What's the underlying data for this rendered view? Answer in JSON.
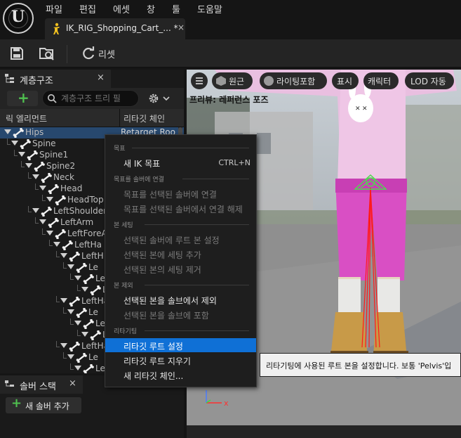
{
  "menubar": {
    "items": [
      "파일",
      "편집",
      "에셋",
      "창",
      "툴",
      "도움말"
    ]
  },
  "tab": {
    "title": "IK_RIG_Shopping_Cart_...",
    "modified_marker": "*",
    "close": "×"
  },
  "toolbar": {
    "reset_label": "리셋"
  },
  "hierarchy": {
    "tab_label": "계층구조",
    "close": "×",
    "search_placeholder": "계층구조 트리 필",
    "columns": [
      "릭 엘리먼트",
      "리타깃 체인"
    ],
    "rows": [
      {
        "name": "Hips",
        "chain": "Retarget Roo",
        "depth": 0,
        "selected": true
      },
      {
        "name": "Spine",
        "depth": 1
      },
      {
        "name": "Spine1",
        "depth": 2
      },
      {
        "name": "Spine2",
        "depth": 3
      },
      {
        "name": "Neck",
        "depth": 4
      },
      {
        "name": "Head",
        "depth": 5
      },
      {
        "name": "HeadTop",
        "depth": 6
      },
      {
        "name": "LeftShoulder",
        "depth": 4
      },
      {
        "name": "LeftArm",
        "depth": 5
      },
      {
        "name": "LeftForeA",
        "depth": 6
      },
      {
        "name": "LeftHa",
        "depth": 7
      },
      {
        "name": "LeftH",
        "depth": 8
      },
      {
        "name": "Le",
        "depth": 9
      },
      {
        "name": "Le",
        "depth": 10
      },
      {
        "name": "Le",
        "depth": 11
      },
      {
        "name": "LeftHa",
        "depth": 8
      },
      {
        "name": "Le",
        "depth": 9
      },
      {
        "name": "Le",
        "depth": 10
      },
      {
        "name": "Le",
        "depth": 11
      },
      {
        "name": "LeftHa",
        "depth": 8
      },
      {
        "name": "Le",
        "depth": 9
      },
      {
        "name": "Le",
        "depth": 10
      }
    ]
  },
  "solver_stack": {
    "tab_label": "솔버 스택",
    "close": "×",
    "add_button": "새 솔버 추가"
  },
  "viewport": {
    "buttons": [
      "원근",
      "라이팅포함",
      "표시",
      "캐릭터",
      "LOD 자동"
    ],
    "preview_label": "프리뷰: 레퍼런스 포즈",
    "axis_x": "x"
  },
  "context_menu": {
    "sections": [
      {
        "header": "목표",
        "items": [
          {
            "label": "새 IK 목표",
            "shortcut": "CTRL+N",
            "enabled": true
          }
        ]
      },
      {
        "header": "목표를 솔버에 연결",
        "items": [
          {
            "label": "목표를 선택된 솔버에 연결",
            "enabled": false
          },
          {
            "label": "목표를 선택된 솔버에서 연결 해제",
            "enabled": false
          }
        ]
      },
      {
        "header": "본 세팅",
        "items": [
          {
            "label": "선택된 솔버에 루트 본 설정",
            "enabled": false
          },
          {
            "label": "선택된 본에 세팅 추가",
            "enabled": false
          },
          {
            "label": "선택된 본의 세팅 제거",
            "enabled": false
          }
        ]
      },
      {
        "header": "본 제외",
        "items": [
          {
            "label": "선택된 본을 솔브에서 제외",
            "enabled": true
          },
          {
            "label": "선택된 본을 솔브에 포함",
            "enabled": false
          }
        ]
      },
      {
        "header": "리타기팅",
        "items": [
          {
            "label": "리타깃 루트 설정",
            "enabled": true,
            "highlighted": true
          },
          {
            "label": "리타깃 루트 지우기",
            "enabled": true
          },
          {
            "label": "새 리타깃 체인...",
            "enabled": true
          }
        ]
      }
    ]
  },
  "tooltip": {
    "text": "리타기팅에 사용된 루트 본을 설정합니다. 보통 'Pelvis'입"
  },
  "colors": {
    "highlight": "#0f70d6",
    "selected_row": "#27486e",
    "add_green": "#4fc04f"
  }
}
